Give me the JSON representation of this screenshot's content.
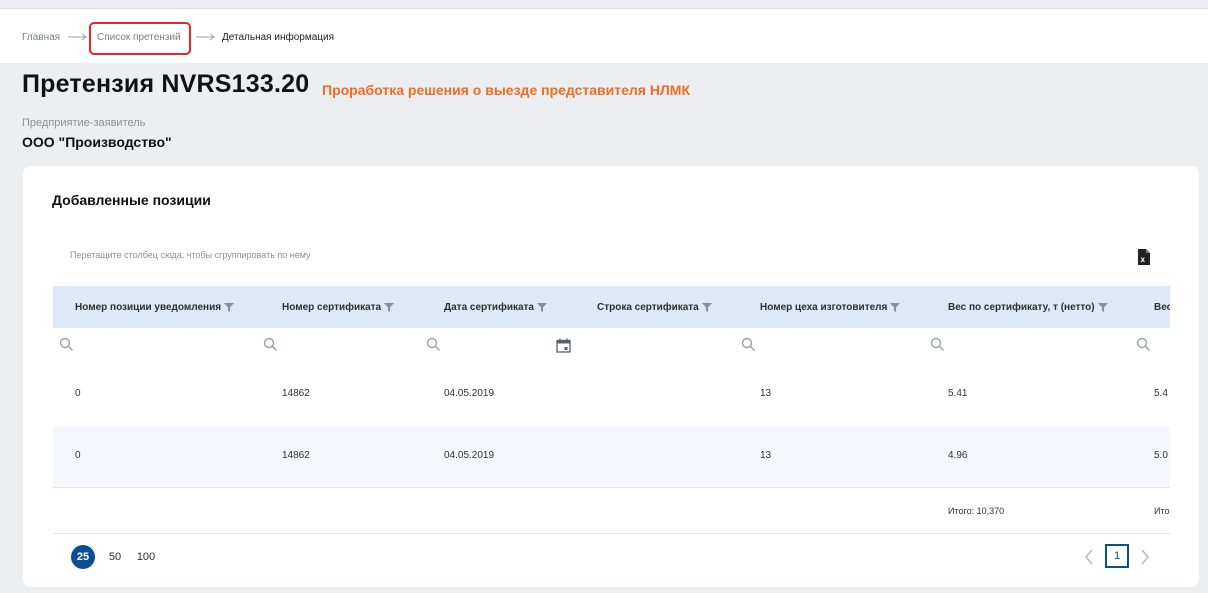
{
  "breadcrumb": {
    "home": "Главная",
    "list": "Список претензий",
    "current": "Детальная информация"
  },
  "header": {
    "title": "Претензия NVRS133.20",
    "status": "Проработка решения о выезде представителя НЛМК",
    "org_label": "Предприятие-заявитель",
    "org_value": "ООО \"Производство\""
  },
  "section": {
    "title": "Добавленные позиции",
    "group_hint": "Перетащите столбец сюда, чтобы сгруппировать по нему"
  },
  "table": {
    "columns": [
      "Номер позиции уведомления",
      "Номер сертификата",
      "Дата сертификата",
      "Строка сертификата",
      "Номер цеха изготовителя",
      "Вес по сертификату, т (нетто)",
      "Вес"
    ],
    "rows": [
      [
        "0",
        "14862",
        "04.05.2019",
        "",
        "13",
        "5.41",
        "5.4"
      ],
      [
        "0",
        "14862",
        "04.05.2019",
        "",
        "13",
        "4.96",
        "5.0"
      ]
    ],
    "totals": {
      "col5": "Итого: 10,370",
      "col6": "Ито"
    }
  },
  "pager": {
    "sizes": [
      "25",
      "50",
      "100"
    ],
    "selected_size": "25",
    "current_page": "1"
  },
  "colors": {
    "accent": "#f26b21",
    "primary": "#0b4f93",
    "header_bg": "#dde9f7",
    "highlight": "#e5262b"
  }
}
